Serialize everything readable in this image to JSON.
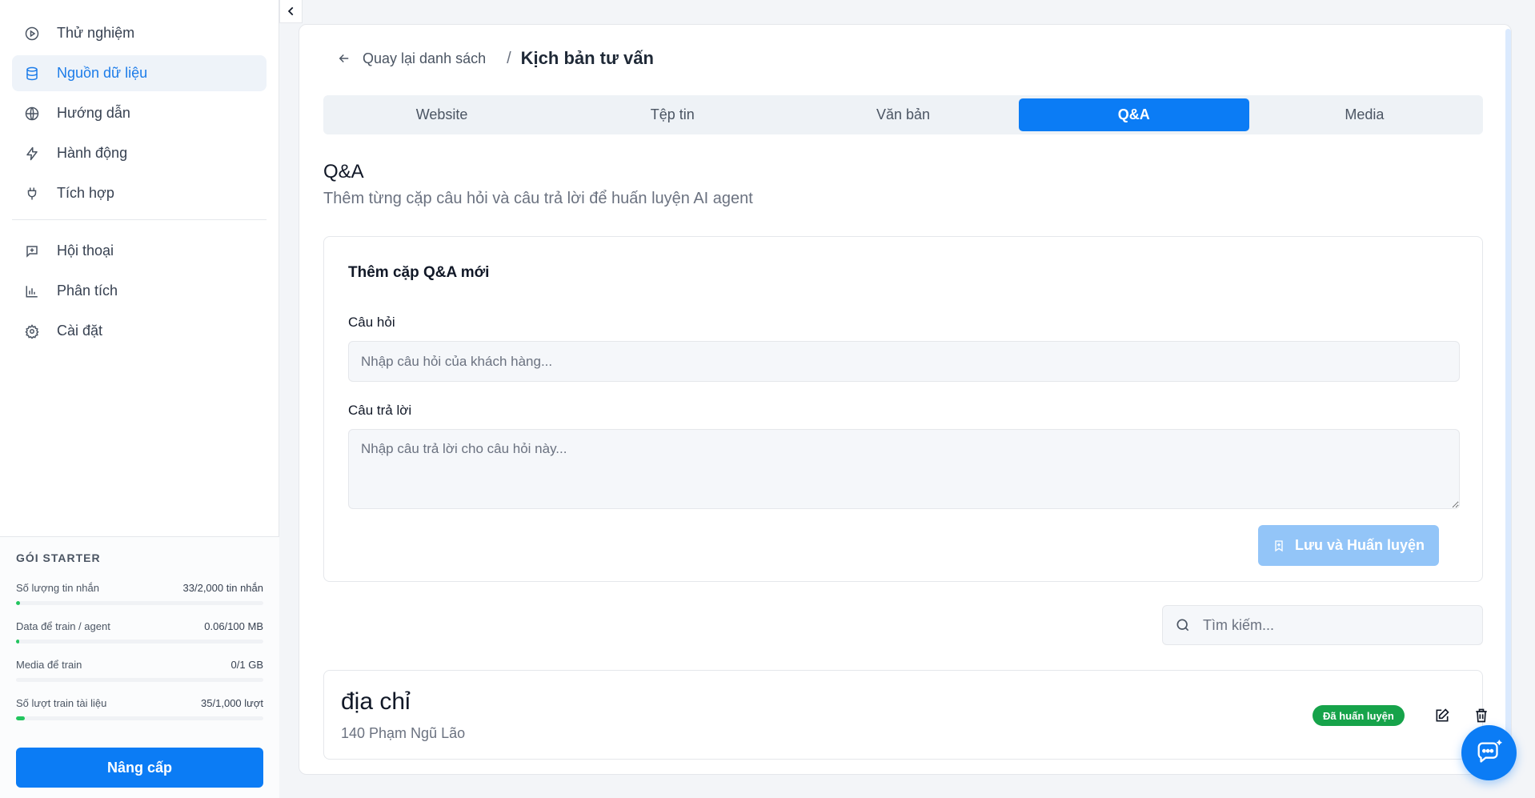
{
  "sidebar": {
    "items": [
      {
        "label": "Thử nghiệm",
        "icon": "play-circle-icon"
      },
      {
        "label": "Nguồn dữ liệu",
        "icon": "database-icon"
      },
      {
        "label": "Hướng dẫn",
        "icon": "globe-icon"
      },
      {
        "label": "Hành động",
        "icon": "lightning-icon"
      },
      {
        "label": "Tích hợp",
        "icon": "plug-icon"
      },
      {
        "label": "Hội thoại",
        "icon": "message-plus-icon"
      },
      {
        "label": "Phân tích",
        "icon": "bar-chart-icon"
      },
      {
        "label": "Cài đặt",
        "icon": "gear-icon"
      }
    ],
    "active_index": 1
  },
  "plan": {
    "title": "GÓI STARTER",
    "usage": [
      {
        "label": "Số lượng tin nhắn",
        "value": "33/2,000 tin nhắn",
        "fraction": 0.0165
      },
      {
        "label": "Data để train / agent",
        "value": "0.06/100 MB",
        "fraction": 0.0006
      },
      {
        "label": "Media để train",
        "value": "0/1 GB",
        "fraction": 0
      },
      {
        "label": "Số lượt train tài liệu",
        "value": "35/1,000 lượt",
        "fraction": 0.035
      }
    ],
    "upgrade_label": "Nâng cấp"
  },
  "breadcrumb": {
    "back_label": "Quay lại danh sách",
    "separator": "/",
    "title": "Kịch bản tư vấn"
  },
  "tabs": [
    {
      "label": "Website"
    },
    {
      "label": "Tệp tin"
    },
    {
      "label": "Văn bản"
    },
    {
      "label": "Q&A"
    },
    {
      "label": "Media"
    }
  ],
  "active_tab": 3,
  "section": {
    "title": "Q&A",
    "subtitle": "Thêm từng cặp câu hỏi và câu trả lời để huấn luyện AI agent"
  },
  "form": {
    "title": "Thêm cặp Q&A mới",
    "question_label": "Câu hỏi",
    "question_placeholder": "Nhập câu hỏi của khách hàng...",
    "answer_label": "Câu trả lời",
    "answer_placeholder": "Nhập câu trả lời cho câu hỏi này...",
    "save_label": "Lưu và Huấn luyện"
  },
  "search": {
    "placeholder": "Tìm kiếm..."
  },
  "qa_items": [
    {
      "question": "địa chỉ",
      "answer": "140 Phạm Ngũ Lão",
      "status": "Đã huấn luyện"
    }
  ],
  "colors": {
    "accent": "#0b7cf5",
    "success": "#16a34a",
    "disabled_button": "#93c5f8"
  }
}
